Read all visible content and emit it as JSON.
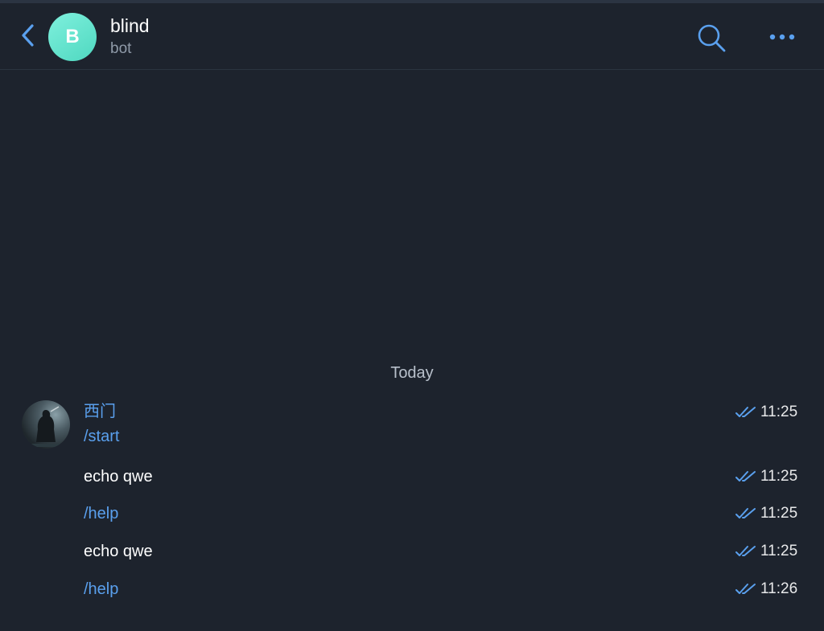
{
  "header": {
    "back_icon": "chevron-left-icon",
    "avatar_letter": "B",
    "avatar_color": "#5de0cb",
    "title": "blind",
    "subtitle": "bot",
    "search_icon": "search-icon",
    "more_icon": "more-horizontal-icon"
  },
  "chat": {
    "date_separator": "Today",
    "sender": {
      "name": "西门",
      "name_color": "#5aa0ee"
    },
    "messages": [
      {
        "text": "/start",
        "kind": "command",
        "time": "11:25",
        "status": "read"
      },
      {
        "text": "echo qwe",
        "kind": "text",
        "time": "11:25",
        "status": "read"
      },
      {
        "text": "/help",
        "kind": "command",
        "time": "11:25",
        "status": "read"
      },
      {
        "text": "echo qwe",
        "kind": "text",
        "time": "11:25",
        "status": "read"
      },
      {
        "text": "/help",
        "kind": "command",
        "time": "11:26",
        "status": "read"
      }
    ]
  },
  "colors": {
    "background": "#1d232d",
    "accent": "#5aa0ee",
    "text": "#ffffff",
    "muted": "#8f9aa8"
  }
}
